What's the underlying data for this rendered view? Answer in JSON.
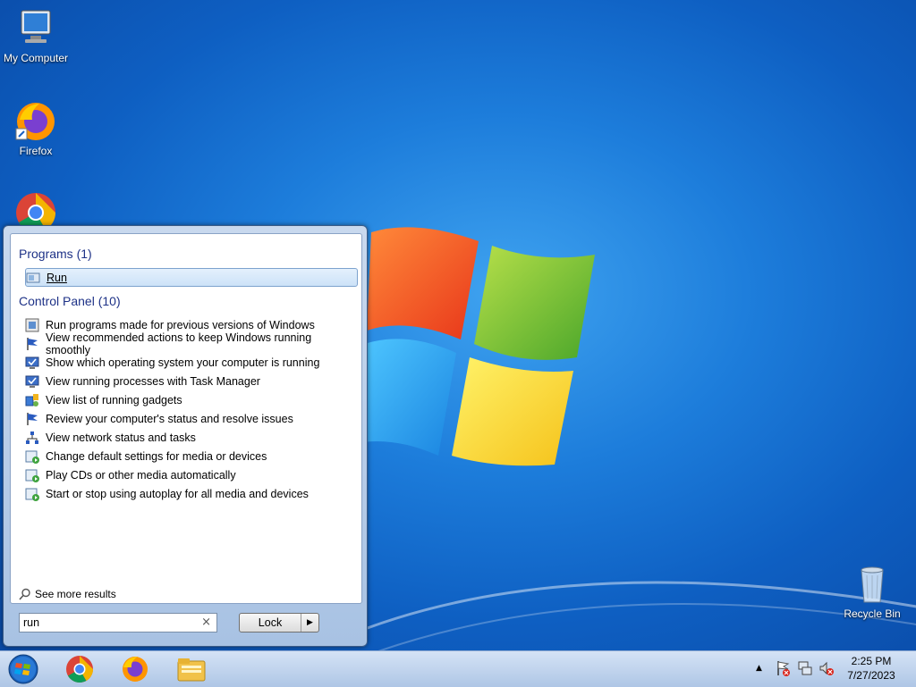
{
  "desktop": {
    "icons": [
      {
        "label": "My Computer",
        "icon": "computer-icon"
      },
      {
        "label": "Firefox",
        "icon": "firefox-icon"
      },
      {
        "label": "",
        "icon": "chrome-icon"
      },
      {
        "label": "Recycle Bin",
        "icon": "recycle-bin-icon"
      }
    ]
  },
  "start_menu": {
    "programs_title": "Programs (1)",
    "programs": [
      {
        "label": "Run",
        "icon": "run-icon"
      }
    ],
    "control_panel_title": "Control Panel (10)",
    "control_panel": [
      {
        "label": "Run programs made for previous versions of Windows",
        "icon": "compatibility-icon"
      },
      {
        "label": "View recommended actions to keep Windows running smoothly",
        "icon": "action-center-flag-icon"
      },
      {
        "label": "Show which operating system your computer is running",
        "icon": "system-icon"
      },
      {
        "label": "View running processes with Task Manager",
        "icon": "system-icon"
      },
      {
        "label": "View list of running gadgets",
        "icon": "gadgets-icon"
      },
      {
        "label": "Review your computer's status and resolve issues",
        "icon": "action-center-flag-icon"
      },
      {
        "label": "View network status and tasks",
        "icon": "network-icon"
      },
      {
        "label": "Change default settings for media or devices",
        "icon": "autoplay-icon"
      },
      {
        "label": "Play CDs or other media automatically",
        "icon": "autoplay-icon"
      },
      {
        "label": "Start or stop using autoplay for all media and devices",
        "icon": "autoplay-icon"
      }
    ],
    "see_more": "See more results",
    "search_value": "run",
    "clear_symbol": "×",
    "lock_label": "Lock",
    "lock_arrow": "▶"
  },
  "taskbar": {
    "pinned": [
      "chrome-icon",
      "firefox-icon",
      "file-explorer-icon"
    ],
    "tray_arrow": "▲",
    "time": "2:25 PM",
    "date": "7/27/2023"
  }
}
